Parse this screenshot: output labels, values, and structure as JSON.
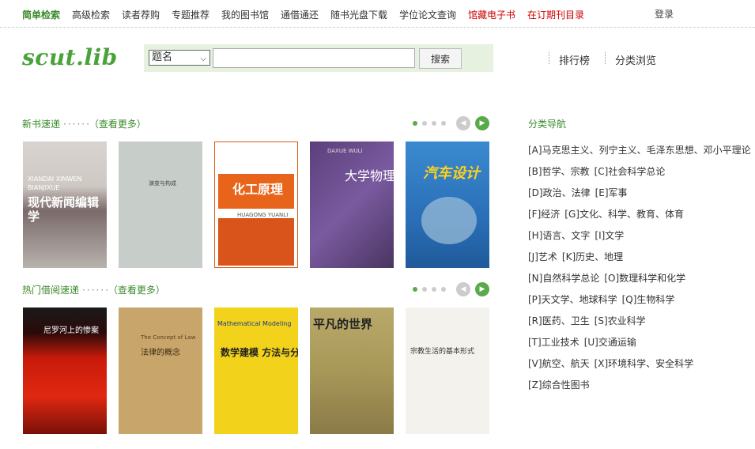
{
  "topnav": {
    "items": [
      "简单检索",
      "高级检索",
      "读者荐购",
      "专题推荐",
      "我的图书馆",
      "通借通还",
      "随书光盘下载",
      "学位论文查询",
      "馆藏电子书",
      "在订期刊目录"
    ],
    "login": "登录"
  },
  "logo": "scut.lib",
  "search": {
    "field_selected": "题名",
    "query": "",
    "button": "搜索"
  },
  "links": {
    "ranking": "排行榜",
    "browse": "分类浏览"
  },
  "new_books": {
    "title": "新书速递",
    "dots": "······",
    "more": "（查看更多）",
    "covers": [
      {
        "title": "现代新闻编辑学",
        "sub": "XIANDAI XINWEN BIANJIXUE"
      },
      {
        "title": "演变与构成",
        "sub": ""
      },
      {
        "title": "化工原理",
        "sub": "HUAGONG YUANLI"
      },
      {
        "title": "大学物理",
        "sub": "DAXUE WULI"
      },
      {
        "title": "汽车设计",
        "sub": ""
      }
    ]
  },
  "hot_books": {
    "title": "热门借阅速递",
    "dots": "······",
    "more": "（查看更多）",
    "covers": [
      {
        "title": "尼罗河上的惨案",
        "sub": ""
      },
      {
        "title": "法律的概念",
        "sub": "The Concept of Law"
      },
      {
        "title": "数学建模 方法与分析",
        "sub": "Mathematical Modeling"
      },
      {
        "title": "平凡的世界",
        "sub": ""
      },
      {
        "title": "宗教生活的基本形式",
        "sub": ""
      }
    ]
  },
  "categories": {
    "title": "分类导航",
    "rows": [
      [
        "[A]马克思主义、列宁主义、毛泽东思想、邓小平理论"
      ],
      [
        "[B]哲学、宗教",
        "[C]社会科学总论"
      ],
      [
        "[D]政治、法律",
        "[E]军事"
      ],
      [
        "[F]经济",
        "[G]文化、科学、教育、体育"
      ],
      [
        "[H]语言、文字",
        "[I]文学"
      ],
      [
        "[J]艺术",
        "[K]历史、地理"
      ],
      [
        "[N]自然科学总论",
        "[O]数理科学和化学"
      ],
      [
        "[P]天文学、地球科学",
        "[Q]生物科学"
      ],
      [
        "[R]医药、卫生",
        "[S]农业科学"
      ],
      [
        "[T]工业技术",
        "[U]交通运输"
      ],
      [
        "[V]航空、航天",
        "[X]环境科学、安全科学"
      ],
      [
        "[Z]综合性图书"
      ]
    ]
  },
  "colors": {
    "accent": "#3a8a2a",
    "red": "#cc0000",
    "search_bg": "#e6f2df"
  }
}
